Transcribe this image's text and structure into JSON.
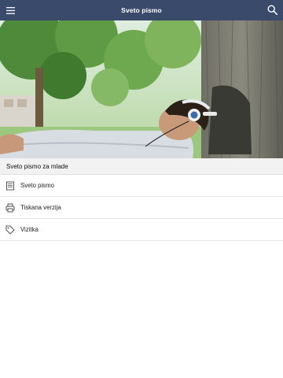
{
  "appbar": {
    "title": "Sveto pismo",
    "menu_icon": "hamburger-menu-icon",
    "search_icon": "search-icon"
  },
  "hero": {
    "alt": "Mladenič s slušalkami počiva ob drevesu"
  },
  "section": {
    "title": "Sveto pismo za mlade"
  },
  "menu": {
    "items": [
      {
        "label": "Sveto pismo",
        "icon": "document-lines-icon"
      },
      {
        "label": "Tiskana verzija",
        "icon": "printer-icon"
      },
      {
        "label": "Vizitka",
        "icon": "tag-icon"
      }
    ]
  },
  "colors": {
    "appbar": "#3a4a6b",
    "divider": "#e3e3e3"
  }
}
